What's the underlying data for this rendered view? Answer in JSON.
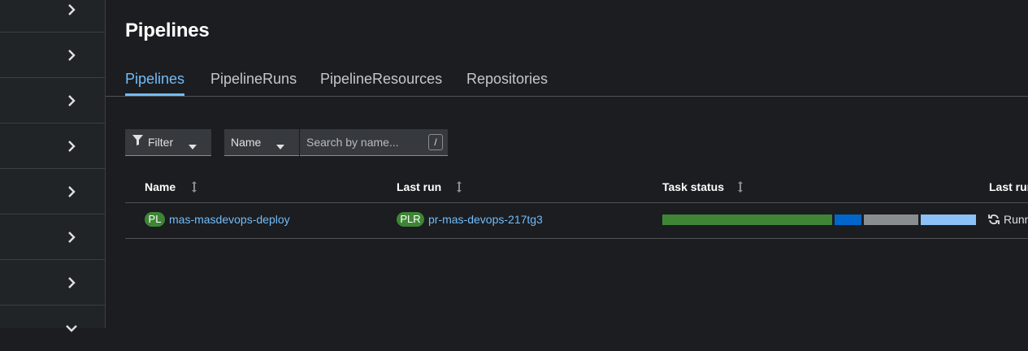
{
  "page": {
    "title": "Pipelines"
  },
  "tabs": [
    {
      "label": "Pipelines",
      "active": true
    },
    {
      "label": "PipelineRuns",
      "active": false
    },
    {
      "label": "PipelineResources",
      "active": false
    },
    {
      "label": "Repositories",
      "active": false
    }
  ],
  "toolbar": {
    "filter_label": "Filter",
    "name_select_value": "Name",
    "search_placeholder": "Search by name...",
    "search_shortcut": "/"
  },
  "table": {
    "columns": [
      "Name",
      "Last run",
      "Task status",
      "Last run status"
    ],
    "rows": [
      {
        "name_badge": "PL",
        "name": "mas-masdevops-deploy",
        "last_run_badge": "PLR",
        "last_run": "pr-mas-devops-217tg3",
        "task_status": [
          {
            "status": "succeeded",
            "weight": 209,
            "color": "#3e8635"
          },
          {
            "status": "running",
            "weight": 33,
            "color": "#0066cc"
          },
          {
            "status": "pending",
            "weight": 67,
            "color": "#8a8d90"
          },
          {
            "status": "skipped",
            "weight": 68,
            "color": "#8bc1f7"
          }
        ],
        "last_run_status": "Running"
      }
    ]
  },
  "colors": {
    "accent": "#73bcf7",
    "badge": "#3e8635",
    "background": "#1b1d21",
    "sidebar": "#212427"
  },
  "icons": {
    "sidebar_expanders": [
      "chevron-right-icon",
      "chevron-right-icon",
      "chevron-right-icon",
      "chevron-right-icon",
      "chevron-right-icon",
      "chevron-right-icon",
      "chevron-right-icon",
      "chevron-down-icon"
    ],
    "filter": "filter-icon",
    "sort": "sort-icon",
    "running": "sync-icon"
  }
}
